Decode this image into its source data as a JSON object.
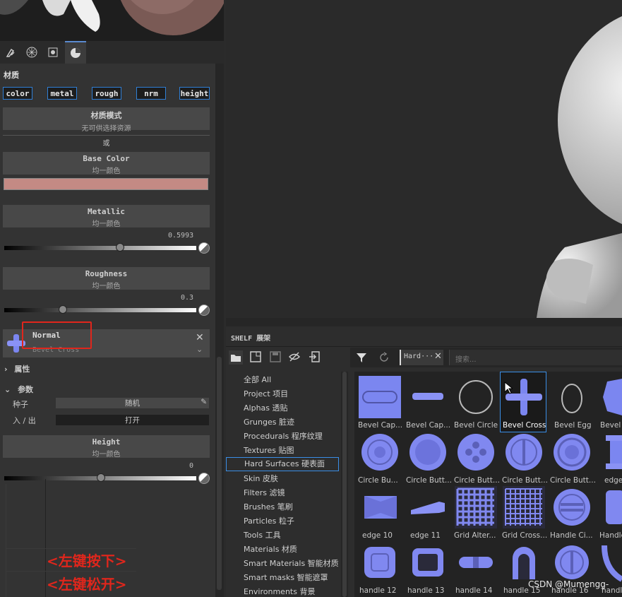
{
  "left_panel": {
    "tabs": [
      "brush-tab",
      "material-tab",
      "mask-tab",
      "properties-tab"
    ],
    "section_title": "材质",
    "channels": [
      "color",
      "metal",
      "rough",
      "nrm",
      "height"
    ],
    "material_mode": {
      "title": "材质模式",
      "subtitle": "无可供选择资源"
    },
    "or_label": "或",
    "base_color": {
      "title": "Base Color",
      "subtitle": "均一颜色",
      "swatch": "#c48a84"
    },
    "metallic": {
      "title": "Metallic",
      "subtitle": "均一颜色",
      "value": "0.5993"
    },
    "roughness": {
      "title": "Roughness",
      "subtitle": "均一颜色",
      "value": "0.3"
    },
    "normal": {
      "title": "Normal",
      "resource": "Bevel Cross"
    },
    "attributes_label": "属性",
    "params_label": "参数",
    "seed": {
      "label": "种子",
      "value": "随机"
    },
    "in_out": {
      "label": "入 / 出",
      "value": "打开"
    },
    "height": {
      "title": "Height",
      "subtitle": "均一颜色",
      "value": "0"
    },
    "annotations": [
      "<左键按下>",
      "<左键松开>"
    ]
  },
  "shelf": {
    "title": "SHELF  展架",
    "filter_tag": "Hard···",
    "search_placeholder": "搜索...",
    "categories": [
      "全部 All",
      "Project 项目",
      "Alphas 透贴",
      "Grunges 脏迹",
      "Procedurals 程序纹理",
      "Textures 贴图",
      "Hard Surfaces 硬表面",
      "Skin 皮肤",
      "Filters 滤镜",
      "Brushes 笔刷",
      "Particles 粒子",
      "Tools 工具",
      "Materials 材质",
      "Smart Materials 智能材质",
      "Smart masks 智能遮罩",
      "Environments 背景"
    ],
    "selected_category": "Hard Surfaces 硬表面",
    "items": [
      [
        "Bevel Cap...",
        "Bevel Cap...",
        "Bevel Circle",
        "Bevel Cross",
        "Bevel Egg",
        "Bevel H"
      ],
      [
        "Circle Bu...",
        "Circle Butt...",
        "Circle Butt...",
        "Circle Butt...",
        "Circle Butt...",
        "edge"
      ],
      [
        "edge 10",
        "edge 11",
        "Grid Alter...",
        "Grid Cross...",
        "Handle Ci...",
        "Handle"
      ],
      [
        "handle 12",
        "handle 13",
        "handle 14",
        "handle 15",
        "handle 16",
        "handle"
      ]
    ],
    "selected_item": "Bevel Cross"
  },
  "watermark": "CSDN @Mumengg-",
  "colors": {
    "accent": "#3a8ee6",
    "annotation_red": "#e0261c",
    "normal_blue": "#7b86f0"
  }
}
